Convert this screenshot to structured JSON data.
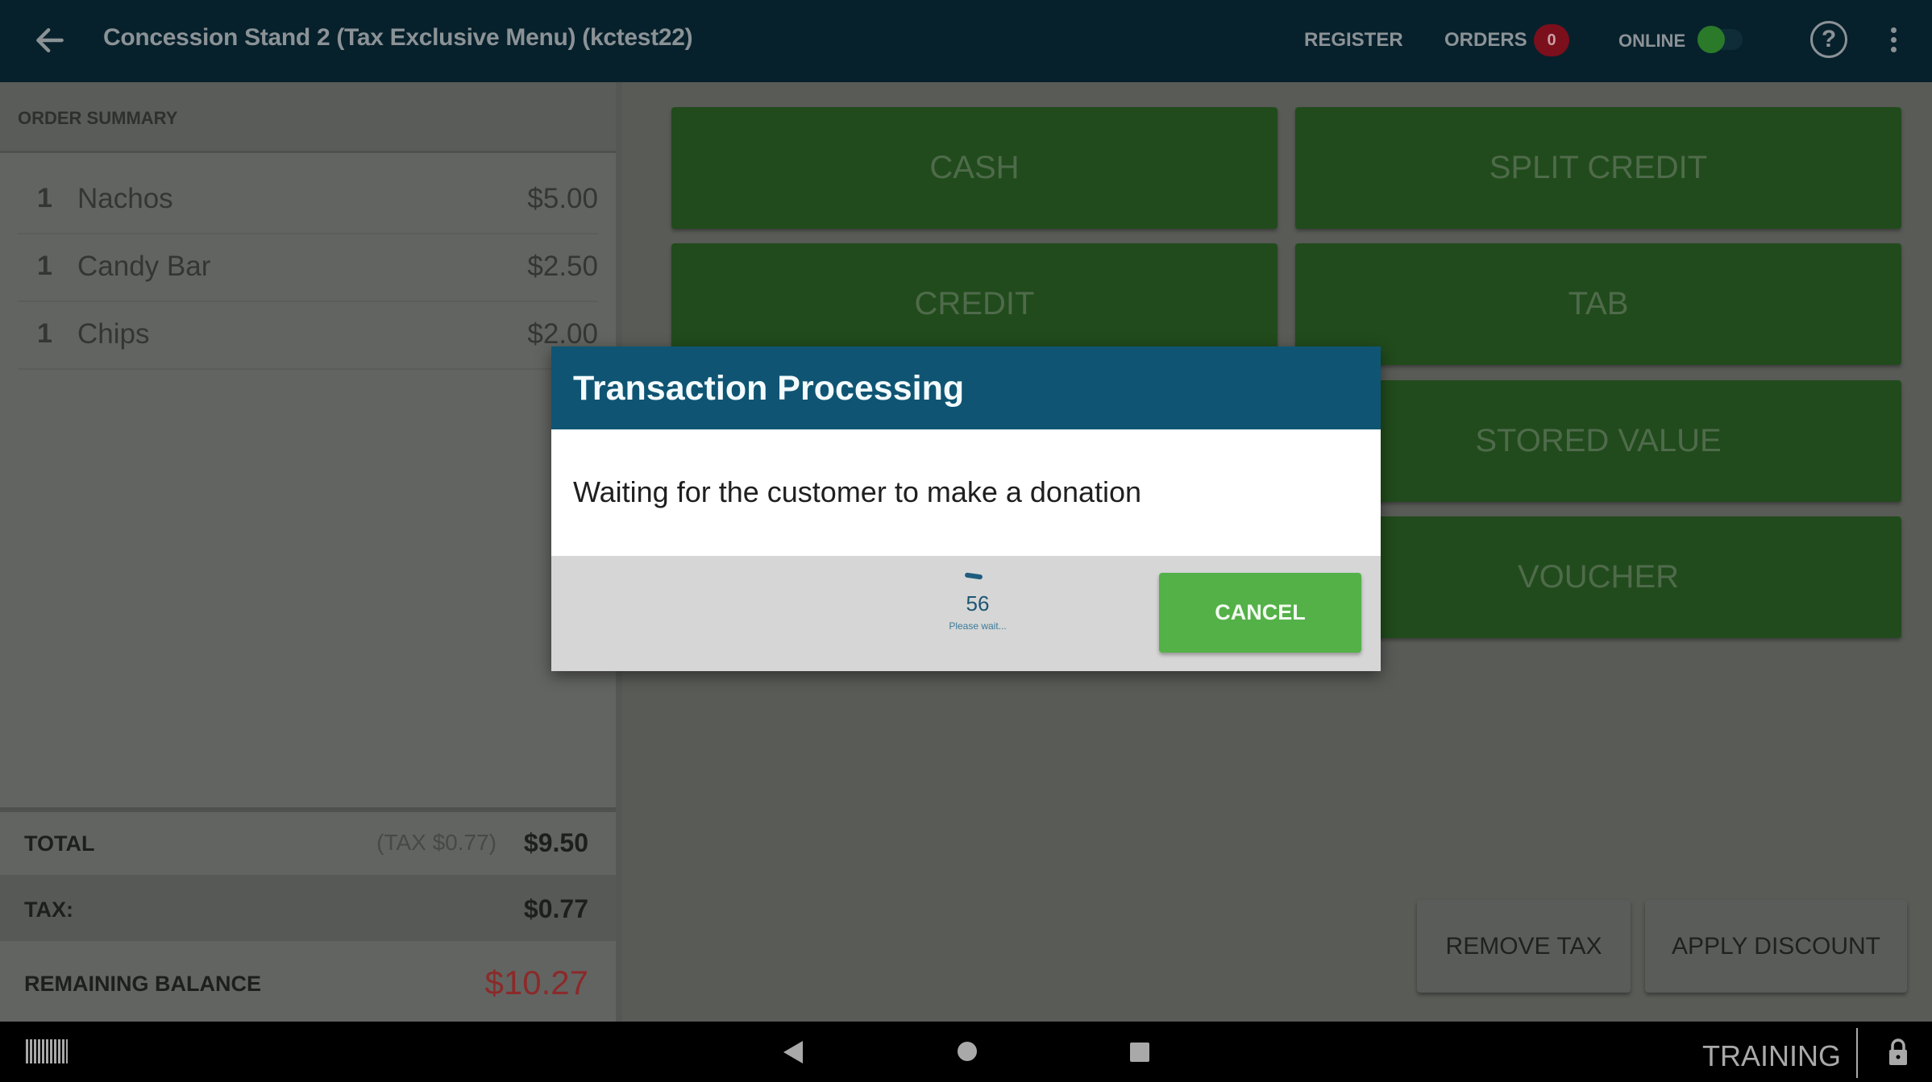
{
  "topbar": {
    "title": "Concession Stand 2 (Tax Exclusive Menu) (kctest22)",
    "register_label": "REGISTER",
    "orders_label": "ORDERS",
    "orders_count": "0",
    "online_label": "ONLINE",
    "online_state": "on",
    "help_glyph": "?"
  },
  "order_summary": {
    "header": "ORDER SUMMARY",
    "items": [
      {
        "qty": "1",
        "name": "Nachos",
        "price": "$5.00"
      },
      {
        "qty": "1",
        "name": "Candy Bar",
        "price": "$2.50"
      },
      {
        "qty": "1",
        "name": "Chips",
        "price": "$2.00"
      }
    ],
    "total_label": "TOTAL",
    "total_tax_note": "(TAX  $0.77)",
    "total_value": "$9.50",
    "tax_label": "TAX:",
    "tax_value": "$0.77",
    "remaining_label": "REMAINING BALANCE",
    "remaining_value": "$10.27"
  },
  "payment_buttons": [
    "CASH",
    "SPLIT CREDIT",
    "CREDIT",
    "TAB",
    "STORED VALUE",
    "VOUCHER"
  ],
  "actions": {
    "remove_tax": "REMOVE TAX",
    "apply_discount": "APPLY DISCOUNT"
  },
  "dialog": {
    "title": "Transaction Processing",
    "message": "Waiting for the customer to make a donation",
    "countdown": "56",
    "wait_text": "Please wait...",
    "cancel_label": "CANCEL"
  },
  "system_bar": {
    "mode_label": "TRAINING"
  },
  "colors": {
    "topbar": "#07212c",
    "payment_green": "#214b1c",
    "dialog_header": "#0f5573",
    "cancel_green": "#53b147",
    "remaining_red": "#8b2a2a",
    "orders_badge": "#7b0f1c"
  }
}
